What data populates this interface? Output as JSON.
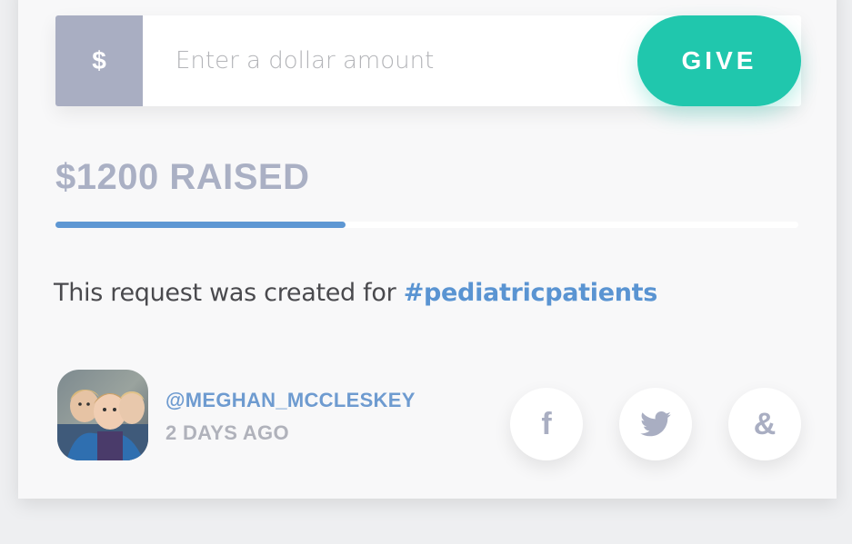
{
  "donation": {
    "currency_symbol": "$",
    "amount_placeholder": "Enter a dollar amount",
    "give_label": "GIVE"
  },
  "progress": {
    "raised_label": "$1200 RAISED",
    "fraction": 0.39
  },
  "request": {
    "text": "This request was created for ",
    "hashtag": "#pediatricpatients"
  },
  "author": {
    "username": "@MEGHAN_MCCLESKEY",
    "posted": "2 DAYS AGO"
  },
  "share": {
    "facebook_glyph": "f",
    "email_glyph": "&"
  },
  "colors": {
    "accent_give": "#20c7ad",
    "progress_fill": "#5e97d3",
    "hashtag": "#5a94d2",
    "muted": "#a9aec2"
  },
  "icons": [
    "dollar-icon",
    "facebook-icon",
    "twitter-icon",
    "ampersand-icon",
    "avatar"
  ]
}
